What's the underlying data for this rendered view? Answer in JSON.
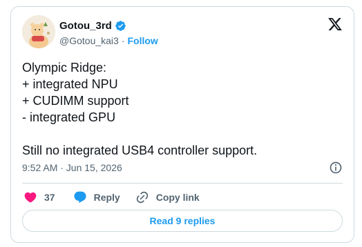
{
  "author": {
    "display_name": "Gotou_3rd",
    "handle": "@Gotou_kai3",
    "separator": "·",
    "follow_label": "Follow",
    "verified": true,
    "avatar_icon": "avatar-drawing-icon"
  },
  "tweet": {
    "lines": [
      "Olympic Ridge:",
      "+ integrated NPU",
      "+ CUDIMM support",
      "- integrated GPU",
      "",
      "Still no integrated USB4 controller support."
    ],
    "timestamp": "9:52 AM · Jun 15, 2026"
  },
  "actions": {
    "like_count": "37",
    "reply_label": "Reply",
    "copy_link_label": "Copy link"
  },
  "footer": {
    "read_replies_label": "Read 9 replies"
  },
  "icons": {
    "brand": "x-logo-icon",
    "verified": "verified-badge-icon",
    "info": "info-icon",
    "like": "heart-icon",
    "reply": "speech-bubble-icon",
    "copy_link": "link-icon"
  },
  "colors": {
    "accent": "#1d9bf0",
    "like": "#f91880",
    "text_primary": "#0f1419",
    "text_secondary": "#536471",
    "border": "#cfd9de"
  }
}
